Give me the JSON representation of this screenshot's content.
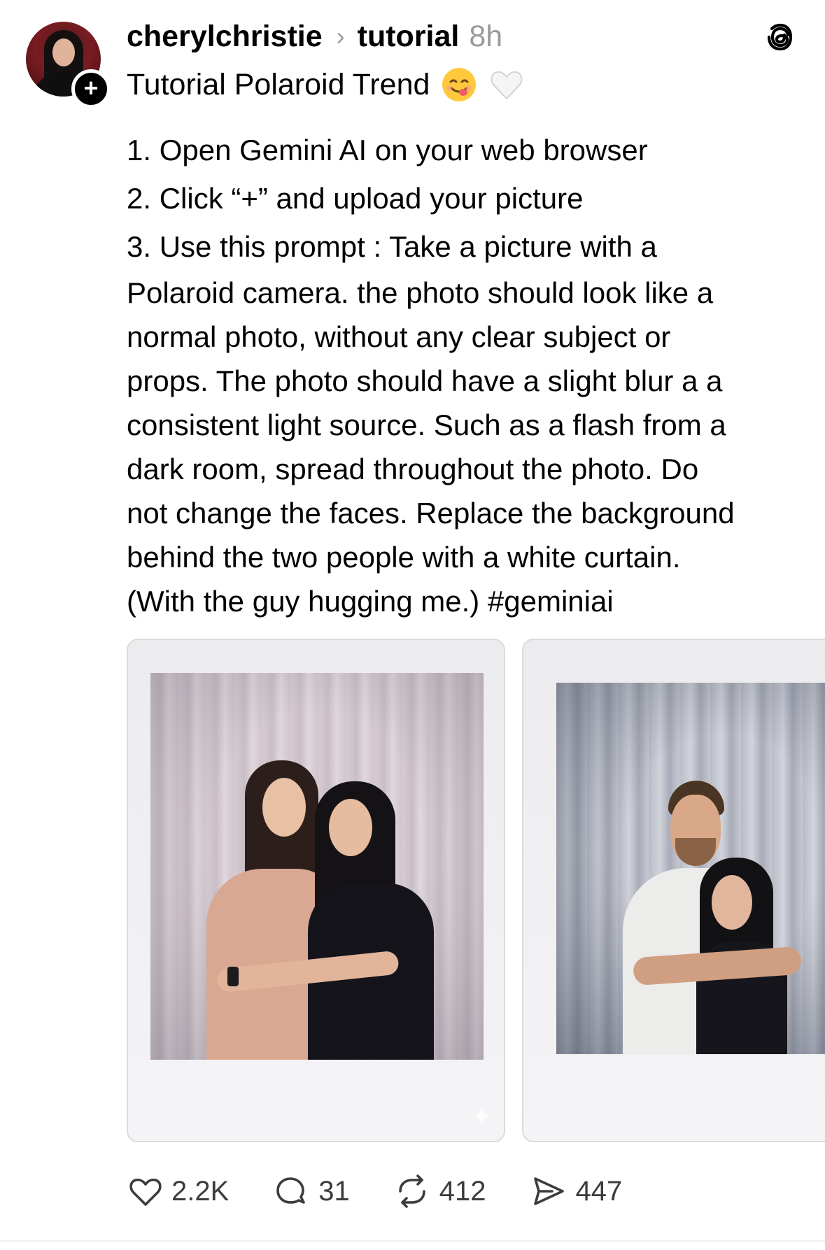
{
  "post": {
    "username": "cherylchristie",
    "topic": "tutorial",
    "time": "8h",
    "title": "Tutorial Polaroid Trend",
    "emojis": [
      "face-savoring-food-emoji",
      "white-heart-emoji"
    ],
    "steps": [
      "1. Open Gemini AI on your web browser",
      "2. Click “+” and upload your picture"
    ],
    "step3_lines": [
      "3. Use this prompt : Take a picture with a",
      "Polaroid camera. the photo should look like a",
      "normal photo, without any clear subject or",
      "props. The photo should have a slight blur a a",
      "consistent light source. Such as a flash from a",
      "dark room, spread throughout the photo. Do",
      "not change the faces. Replace the background",
      "behind the two people with a white curtain.",
      "(With the guy hugging me.) #geminiai"
    ]
  },
  "follow_badge": "+",
  "actions": {
    "likes": "2.2K",
    "replies": "31",
    "reposts": "412",
    "shares": "447"
  },
  "icons": {
    "like": "heart-icon",
    "reply": "comment-icon",
    "repost": "repost-icon",
    "share": "send-icon",
    "app": "threads-logo-icon"
  },
  "colors": {
    "text": "#000000",
    "muted": "#9a9a9a",
    "action_text": "#3c3c3c",
    "avatar_bg": "#7a1c22"
  }
}
